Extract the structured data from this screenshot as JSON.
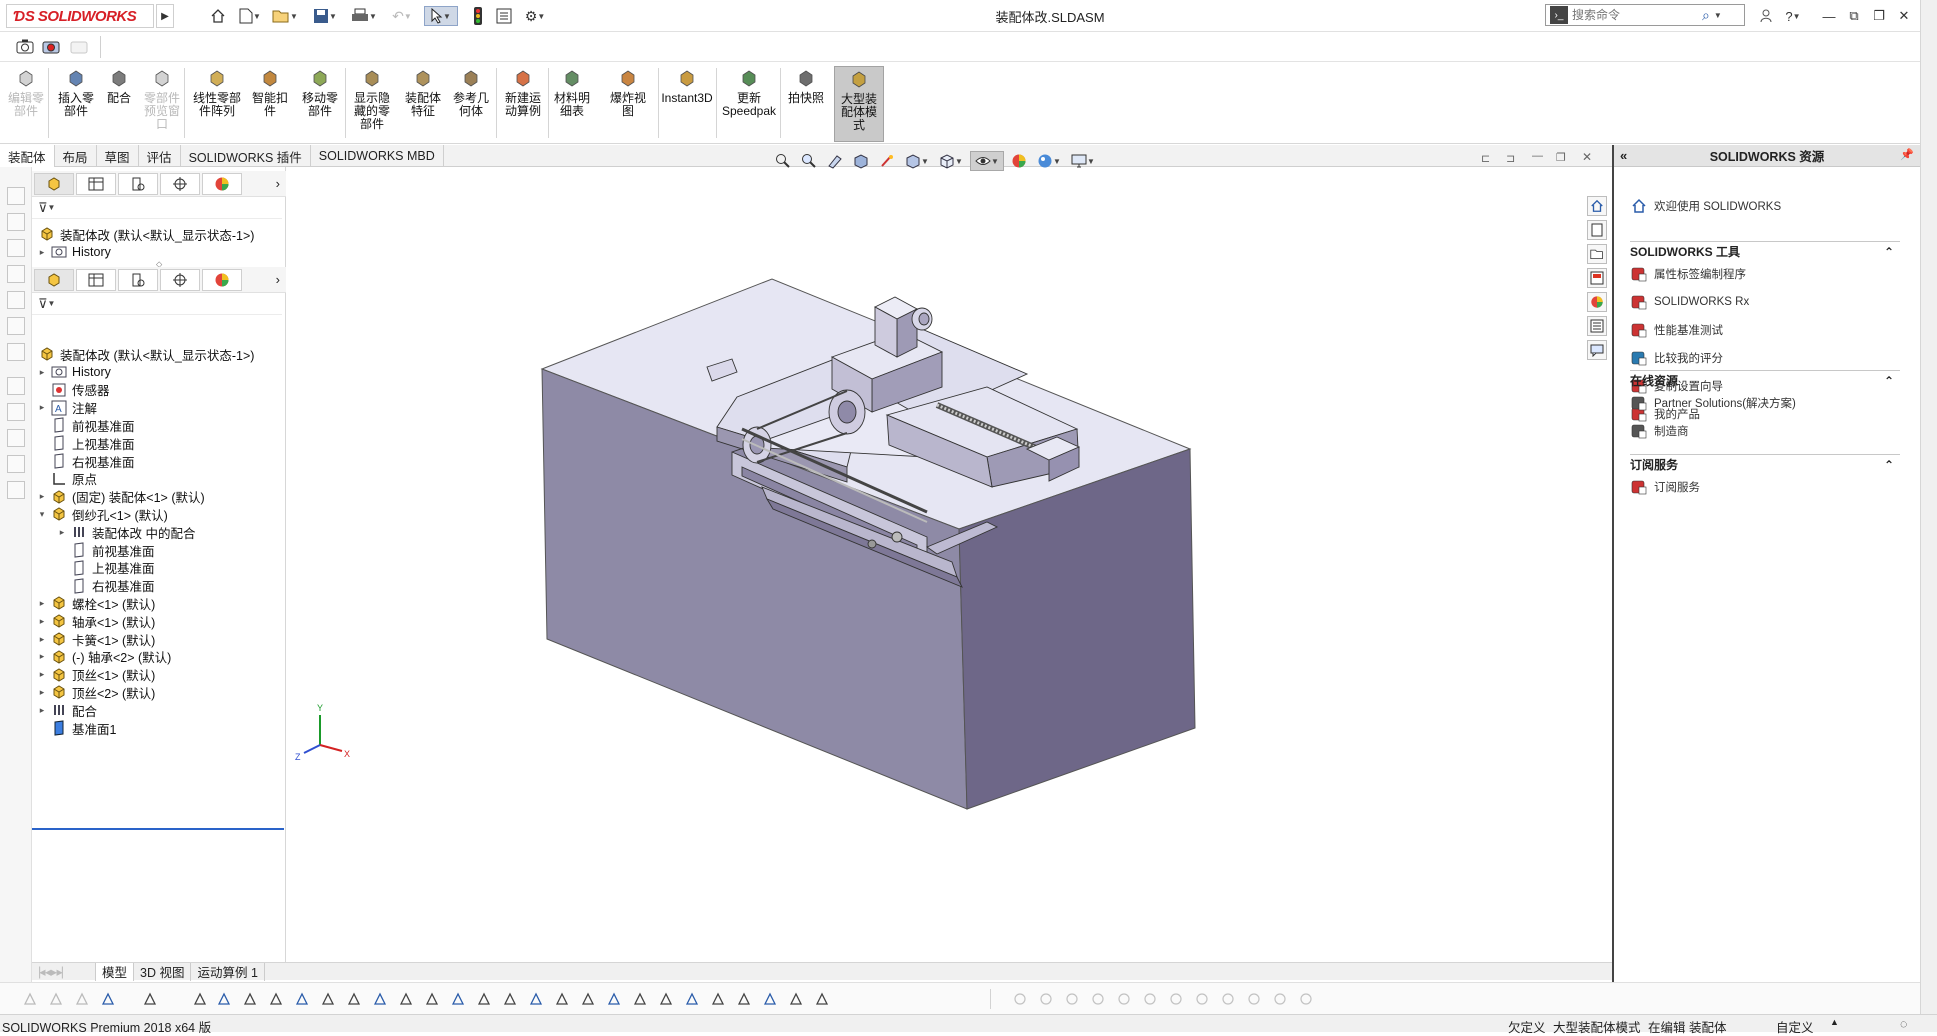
{
  "app": {
    "logo_text": "SOLIDWORKS",
    "doc_title": "装配体改.SLDASM"
  },
  "search": {
    "placeholder": "搜索命令"
  },
  "command_manager": {
    "buttons": [
      {
        "label": "编辑零\n部件",
        "disabled": true
      },
      {
        "label": "插入零\n部件",
        "disabled": false
      },
      {
        "label": "配合",
        "disabled": false
      },
      {
        "label": "零部件\n预览窗\n口",
        "disabled": true
      },
      {
        "label": "线性零部\n件阵列",
        "disabled": false
      },
      {
        "label": "智能扣\n件",
        "disabled": false
      },
      {
        "label": "移动零\n部件",
        "disabled": false
      },
      {
        "label": "显示隐\n藏的零\n部件",
        "disabled": false
      },
      {
        "label": "装配体\n特征",
        "disabled": false
      },
      {
        "label": "参考几\n何体",
        "disabled": false
      },
      {
        "label": "新建运\n动算例",
        "disabled": false
      },
      {
        "label": "材料明\n细表",
        "disabled": false
      },
      {
        "label": "爆炸视\n图",
        "disabled": false
      },
      {
        "label": "Instant3D",
        "disabled": false
      },
      {
        "label": "更新\nSpeedpak",
        "disabled": false
      },
      {
        "label": "拍快照",
        "disabled": false
      },
      {
        "label": "大型装\n配体模\n式",
        "disabled": false
      }
    ]
  },
  "tabs": [
    "装配体",
    "布局",
    "草图",
    "评估",
    "SOLIDWORKS 插件",
    "SOLIDWORKS MBD"
  ],
  "tree_top": {
    "root": "装配体改 (默认<默认_显示状态-1>)",
    "history": "History"
  },
  "tree": {
    "root": "装配体改 (默认<默认_显示状态-1>)",
    "nodes": [
      {
        "label": "History",
        "level": 1,
        "exp": "▸",
        "icon": "history"
      },
      {
        "label": "传感器",
        "level": 1,
        "exp": "",
        "icon": "sensor"
      },
      {
        "label": "注解",
        "level": 1,
        "exp": "▸",
        "icon": "annotation"
      },
      {
        "label": "前视基准面",
        "level": 1,
        "exp": "",
        "icon": "plane"
      },
      {
        "label": "上视基准面",
        "level": 1,
        "exp": "",
        "icon": "plane"
      },
      {
        "label": "右视基准面",
        "level": 1,
        "exp": "",
        "icon": "plane"
      },
      {
        "label": "原点",
        "level": 1,
        "exp": "",
        "icon": "origin"
      },
      {
        "label": "(固定) 装配体<1> (默认)",
        "level": 1,
        "exp": "▸",
        "icon": "assembly"
      },
      {
        "label": "倒纱孔<1> (默认)",
        "level": 1,
        "exp": "▾",
        "icon": "assembly"
      },
      {
        "label": "装配体改 中的配合",
        "level": 2,
        "exp": "▸",
        "icon": "mates"
      },
      {
        "label": "前视基准面",
        "level": 2,
        "exp": "",
        "icon": "plane"
      },
      {
        "label": "上视基准面",
        "level": 2,
        "exp": "",
        "icon": "plane"
      },
      {
        "label": "右视基准面",
        "level": 2,
        "exp": "",
        "icon": "plane"
      },
      {
        "label": "螺栓<1> (默认)",
        "level": 1,
        "exp": "▸",
        "icon": "assembly"
      },
      {
        "label": "轴承<1> (默认)",
        "level": 1,
        "exp": "▸",
        "icon": "assembly"
      },
      {
        "label": "卡簧<1> (默认)",
        "level": 1,
        "exp": "▸",
        "icon": "assembly"
      },
      {
        "label": "(-) 轴承<2> (默认)",
        "level": 1,
        "exp": "▸",
        "icon": "assembly"
      },
      {
        "label": "顶丝<1> (默认)",
        "level": 1,
        "exp": "▸",
        "icon": "assembly"
      },
      {
        "label": "顶丝<2> (默认)",
        "level": 1,
        "exp": "▸",
        "icon": "assembly"
      },
      {
        "label": "配合",
        "level": 1,
        "exp": "▸",
        "icon": "mates"
      },
      {
        "label": "基准面1",
        "level": 1,
        "exp": "",
        "icon": "plane-blue"
      }
    ]
  },
  "bottom_tabs": [
    "模型",
    "3D 视图",
    "运动算例 1"
  ],
  "status": {
    "product": "SOLIDWORKS Premium 2018 x64 版",
    "under_defined": "欠定义",
    "large_mode": "大型装配体模式",
    "editing": "在编辑 装配体",
    "custom": "自定义"
  },
  "taskpane": {
    "title": "SOLIDWORKS 资源",
    "welcome": "欢迎使用 SOLIDWORKS",
    "sections": [
      {
        "title": "SOLIDWORKS 工具",
        "items": [
          "属性标签编制程序",
          "SOLIDWORKS Rx",
          "性能基准测试",
          "比较我的评分",
          "复制设置向导",
          "我的产品"
        ]
      },
      {
        "title": "在线资源",
        "items": [
          "Partner Solutions(解决方案)",
          "制造商"
        ]
      },
      {
        "title": "订阅服务",
        "items": [
          "订阅服务"
        ]
      }
    ]
  },
  "triad": {
    "x": "X",
    "y": "Y",
    "z": "Z"
  },
  "colors": {
    "brand": "#d71f26",
    "model_top": "#e4e4f4",
    "model_left": "#8e8aa6",
    "model_right": "#6e6788"
  }
}
